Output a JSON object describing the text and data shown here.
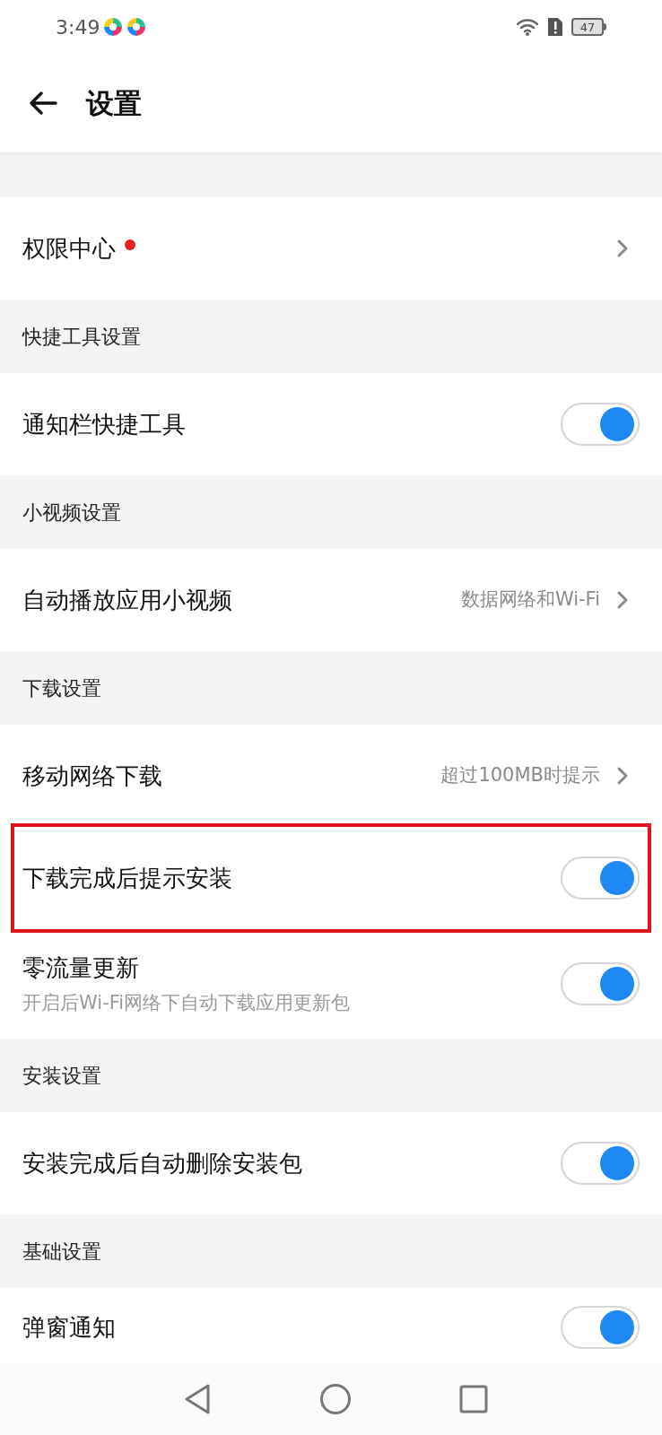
{
  "status_bar": {
    "time": "3:49",
    "battery": "47"
  },
  "header": {
    "title": "设置"
  },
  "sections": [
    {
      "items": [
        {
          "kind": "link",
          "label": "权限中心",
          "badge": true
        }
      ]
    },
    {
      "title": "快捷工具设置",
      "items": [
        {
          "kind": "toggle",
          "label": "通知栏快捷工具",
          "on": true
        }
      ]
    },
    {
      "title": "小视频设置",
      "items": [
        {
          "kind": "link",
          "label": "自动播放应用小视频",
          "value": "数据网络和Wi-Fi"
        }
      ]
    },
    {
      "title": "下载设置",
      "items": [
        {
          "kind": "link",
          "label": "移动网络下载",
          "value": "超过100MB时提示"
        },
        {
          "kind": "toggle",
          "label": "下载完成后提示安装",
          "on": true,
          "highlighted": true
        },
        {
          "kind": "toggle",
          "label": "零流量更新",
          "subtitle": "开启后Wi-Fi网络下自动下载应用更新包",
          "on": true
        }
      ]
    },
    {
      "title": "安装设置",
      "items": [
        {
          "kind": "toggle",
          "label": "安装完成后自动删除安装包",
          "on": true
        }
      ]
    },
    {
      "title": "基础设置",
      "items": [
        {
          "kind": "toggle",
          "label": "弹窗通知",
          "on": true
        }
      ]
    }
  ]
}
